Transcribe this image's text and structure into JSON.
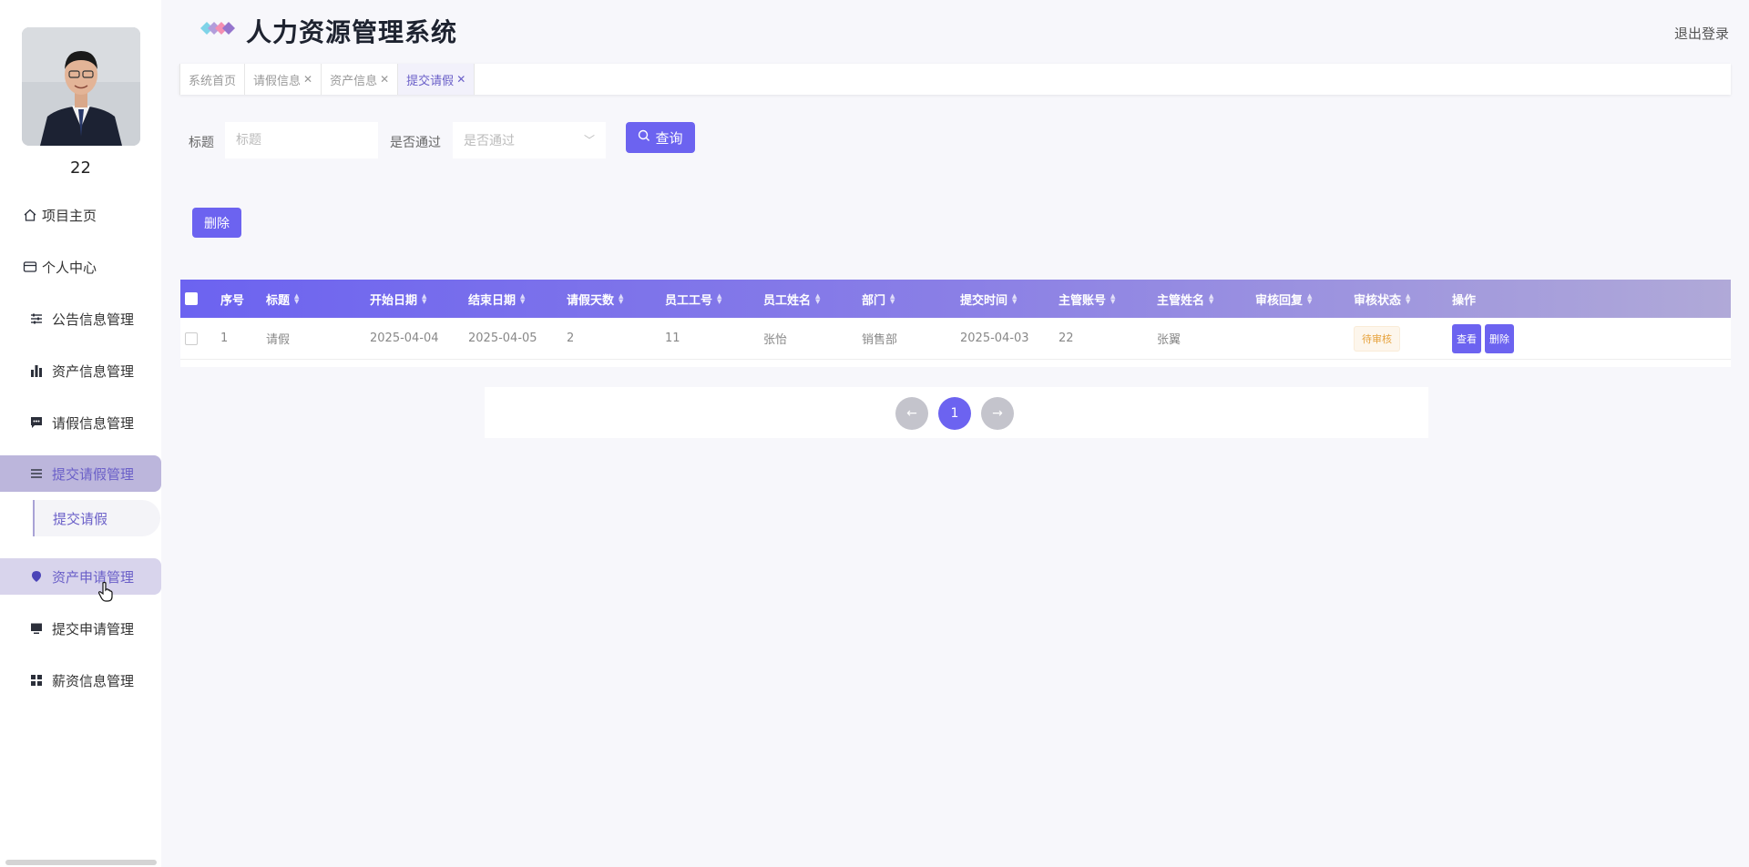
{
  "user": {
    "name": "22"
  },
  "sidebar": {
    "items": [
      {
        "label": "项目主页",
        "icon": "home-icon"
      },
      {
        "label": "个人中心",
        "icon": "card-icon"
      },
      {
        "label": "公告信息管理",
        "icon": "sliders-icon"
      },
      {
        "label": "资产信息管理",
        "icon": "bar-chart-icon"
      },
      {
        "label": "请假信息管理",
        "icon": "message-icon"
      },
      {
        "label": "提交请假管理",
        "icon": "list-icon"
      },
      {
        "label": "资产申请管理",
        "icon": "pin-icon"
      },
      {
        "label": "提交申请管理",
        "icon": "monitor-icon"
      },
      {
        "label": "薪资信息管理",
        "icon": "grid-icon"
      }
    ],
    "submenu_label": "提交请假"
  },
  "header": {
    "title": "人力资源管理系统",
    "logout": "退出登录"
  },
  "tabs": [
    {
      "label": "系统首页",
      "closable": false
    },
    {
      "label": "请假信息",
      "closable": true
    },
    {
      "label": "资产信息",
      "closable": true
    },
    {
      "label": "提交请假",
      "closable": true
    }
  ],
  "search": {
    "title_label": "标题",
    "title_placeholder": "标题",
    "pass_label": "是否通过",
    "pass_placeholder": "是否通过",
    "query_label": "查询"
  },
  "toolbar": {
    "delete_label": "删除"
  },
  "table": {
    "columns": [
      "序号",
      "标题",
      "开始日期",
      "结束日期",
      "请假天数",
      "员工工号",
      "员工姓名",
      "部门",
      "提交时间",
      "主管账号",
      "主管姓名",
      "审核回复",
      "审核状态",
      "操作"
    ],
    "rows": [
      {
        "index": "1",
        "title": "请假",
        "start_date": "2025-04-04",
        "end_date": "2025-04-05",
        "days": "2",
        "emp_no": "11",
        "emp_name": "张怡",
        "dept": "销售部",
        "submit_time": "2025-04-03",
        "mgr_account": "22",
        "mgr_name": "张翼",
        "reply": "",
        "status": "待审核",
        "view_label": "查看",
        "delete_label": "删除"
      }
    ]
  },
  "pagination": {
    "prev": "←",
    "current": "1",
    "next": "→"
  },
  "colors": {
    "accent": "#6c63f0",
    "active_nav_bg": "#bcb6dc",
    "status_pending": "#e6a23c"
  }
}
